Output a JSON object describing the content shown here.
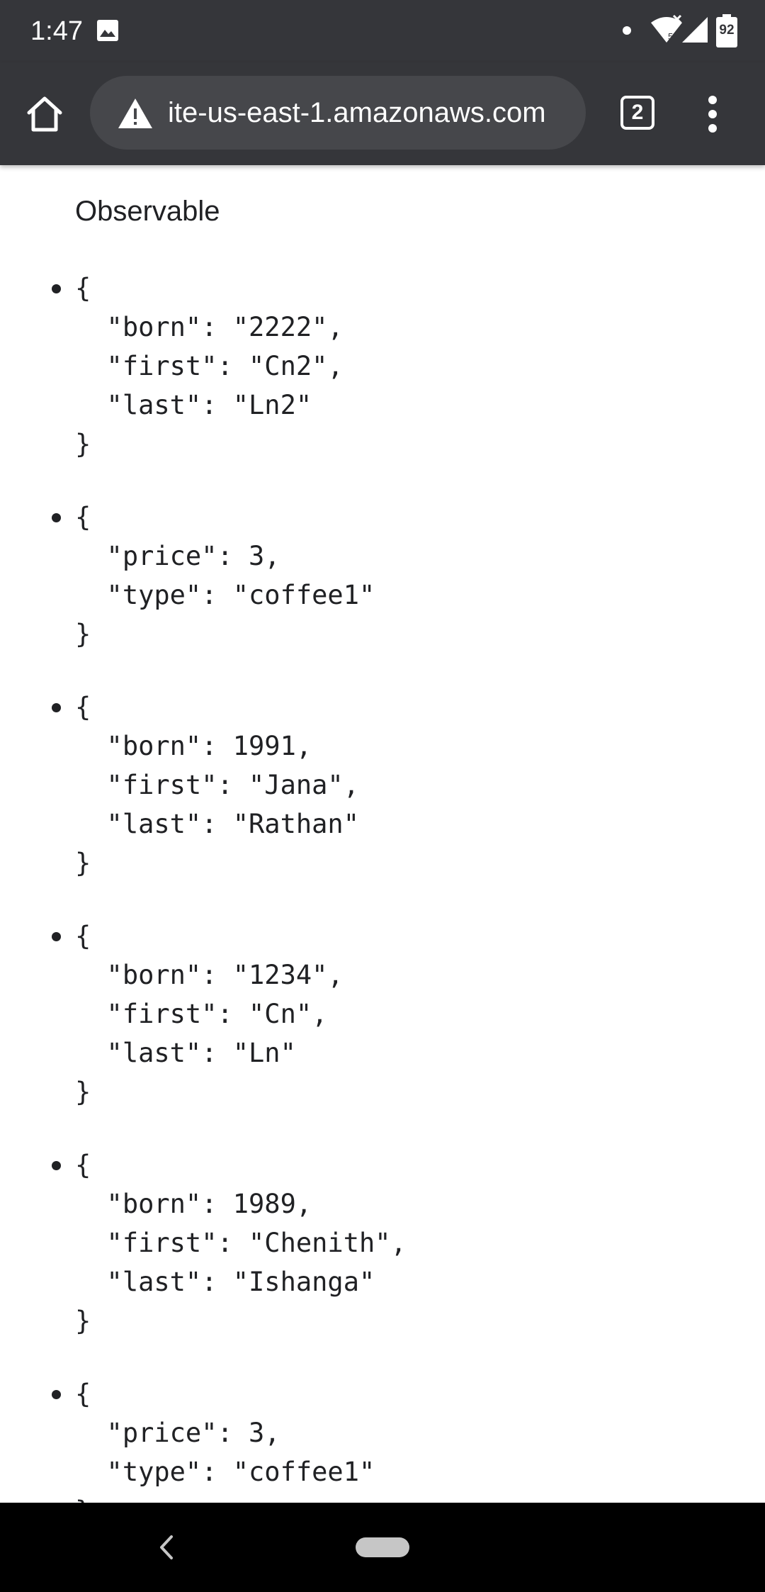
{
  "status_bar": {
    "time": "1:47",
    "battery_level": "92",
    "icons": [
      "gallery-icon",
      "notification-dot",
      "wifi-icon",
      "signal-icon",
      "battery-icon"
    ]
  },
  "toolbar": {
    "url": "ite-us-east-1.amazonaws.com",
    "tab_count": "2",
    "icons": [
      "home-icon",
      "warning-icon",
      "tab-switcher-icon",
      "more-vert-icon"
    ]
  },
  "page": {
    "heading": "Observable",
    "items": [
      "{\n  \"born\": \"2222\",\n  \"first\": \"Cn2\",\n  \"last\": \"Ln2\"\n}",
      "{\n  \"price\": 3,\n  \"type\": \"coffee1\"\n}",
      "{\n  \"born\": 1991,\n  \"first\": \"Jana\",\n  \"last\": \"Rathan\"\n}",
      "{\n  \"born\": \"1234\",\n  \"first\": \"Cn\",\n  \"last\": \"Ln\"\n}",
      "{\n  \"born\": 1989,\n  \"first\": \"Chenith\",\n  \"last\": \"Ishanga\"\n}",
      "{\n  \"price\": 3,\n  \"type\": \"coffee1\"\n}"
    ]
  },
  "nav_bar": {
    "icons": [
      "back-icon",
      "home-pill"
    ]
  },
  "colors": {
    "chrome": "#35363a",
    "url_bar": "#46474b",
    "text": "#202124",
    "nav": "#000000"
  }
}
